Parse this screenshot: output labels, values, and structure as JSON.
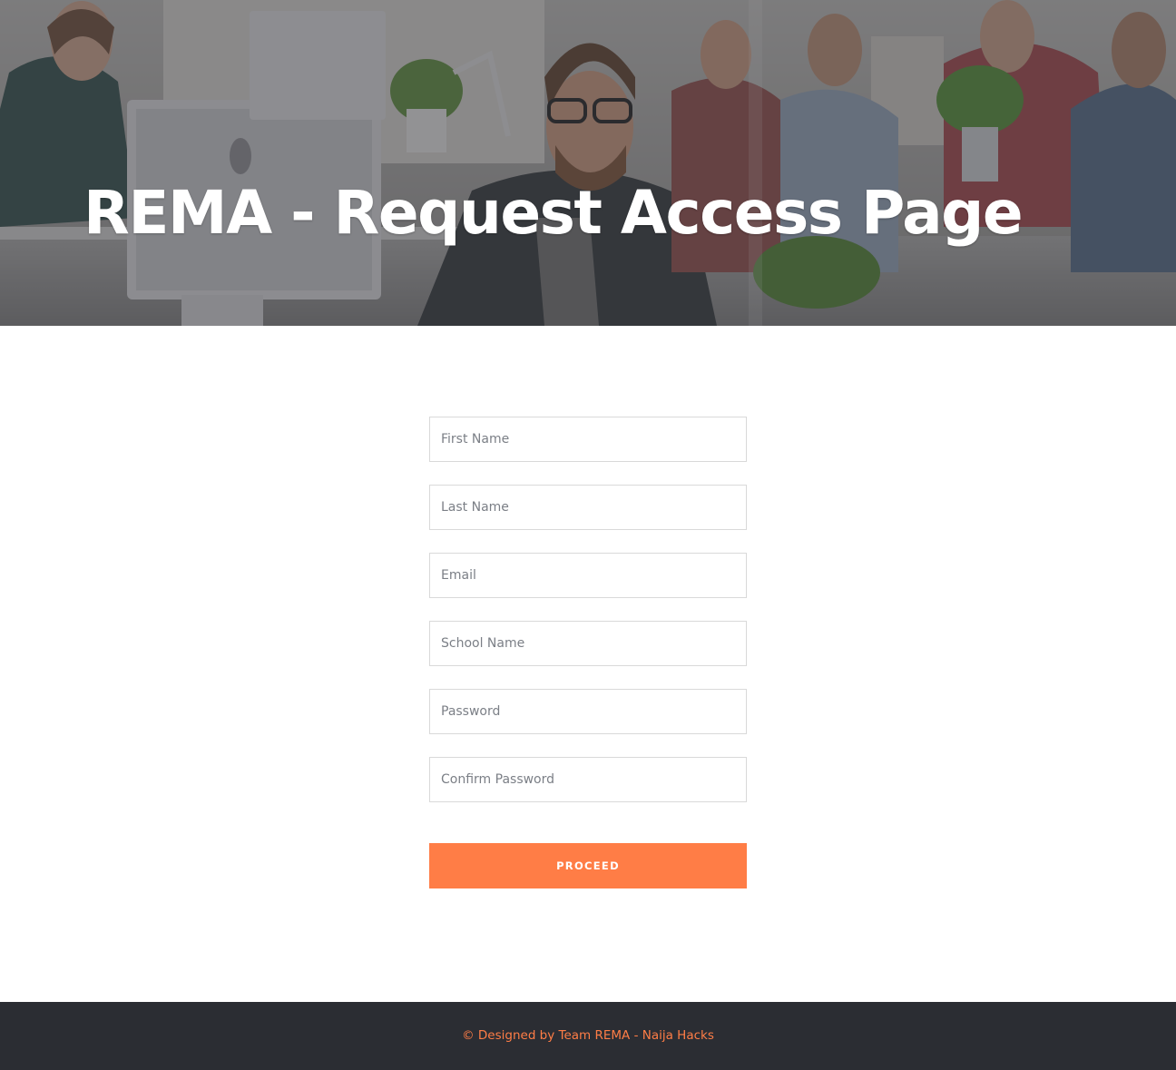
{
  "hero": {
    "title": "REMA - Request Access Page",
    "background_photo": "office-team-at-computers-photo"
  },
  "form": {
    "fields": [
      {
        "name": "first_name",
        "placeholder": "First Name",
        "value": ""
      },
      {
        "name": "last_name",
        "placeholder": "Last Name",
        "value": ""
      },
      {
        "name": "email",
        "placeholder": "Email",
        "value": ""
      },
      {
        "name": "school_name",
        "placeholder": "School Name",
        "value": ""
      },
      {
        "name": "password",
        "placeholder": "Password",
        "value": ""
      },
      {
        "name": "confirm_password",
        "placeholder": "Confirm Password",
        "value": ""
      }
    ],
    "submit_label": "PROCEED"
  },
  "footer": {
    "credit": "© Designed by Team REMA - Naija Hacks"
  },
  "colors": {
    "accent": "#ff7d46",
    "footer_bg": "#2b2d33",
    "input_border": "#d9d9d9",
    "placeholder": "#7b7f86",
    "hero_overlay": "#3a3b40"
  }
}
